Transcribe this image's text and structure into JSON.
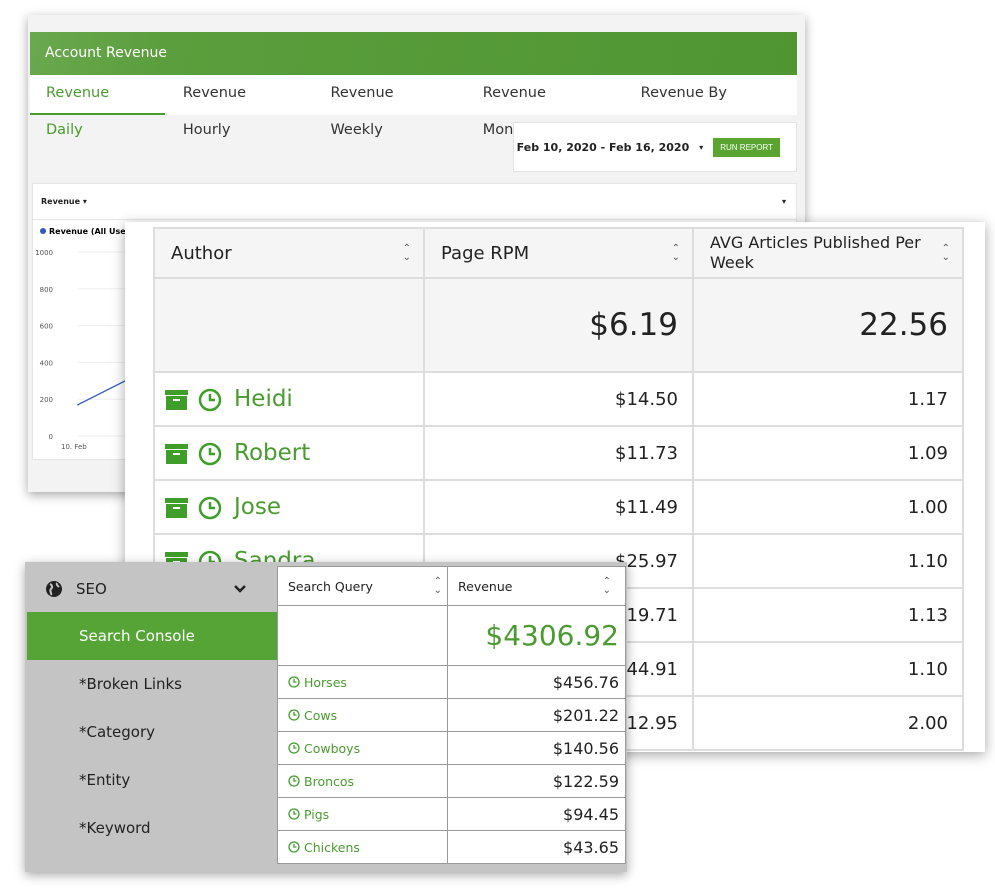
{
  "revenue_panel": {
    "title": "Account Revenue",
    "tabs": [
      "Revenue Daily",
      "Revenue Hourly",
      "Revenue Weekly",
      "Revenue Monthly",
      "Revenue By Device"
    ],
    "active_tab": "Revenue Daily",
    "date_range": "Feb 10, 2020 - Feb 16, 2020",
    "run_report_label": "RUN REPORT",
    "metric_select": "Revenue",
    "accent_color": "#4a9b2f"
  },
  "chart_data": {
    "type": "line",
    "legend": "Revenue (All Users)",
    "series": [
      {
        "name": "Revenue (All Users)",
        "color": "#2f5bb8",
        "values": [
          170
        ]
      }
    ],
    "x": [
      "10. Feb"
    ],
    "yticks": [
      "0",
      "200",
      "400",
      "600",
      "800",
      "1000"
    ],
    "ylim": [
      0,
      1000
    ],
    "grid": true,
    "legend_position": "top-left"
  },
  "author_table": {
    "headers": [
      "Author",
      "Page RPM",
      "AVG Articles Published Per Week"
    ],
    "totals": {
      "page_rpm": "$6.19",
      "avg_articles": "22.56"
    },
    "rows": [
      {
        "author": "Heidi",
        "page_rpm": "$14.50",
        "avg_articles": "1.17"
      },
      {
        "author": "Robert",
        "page_rpm": "$11.73",
        "avg_articles": "1.09"
      },
      {
        "author": "Jose",
        "page_rpm": "$11.49",
        "avg_articles": "1.00"
      },
      {
        "author": "Sandra",
        "page_rpm": "$25.97",
        "avg_articles": "1.10"
      },
      {
        "author": "",
        "page_rpm": "$19.71",
        "avg_articles": "1.13"
      },
      {
        "author": "",
        "page_rpm": "$44.91",
        "avg_articles": "1.10"
      },
      {
        "author": "",
        "page_rpm": "$12.95",
        "avg_articles": "2.00"
      }
    ]
  },
  "seo_panel": {
    "section": "SEO",
    "items": [
      "Search Console",
      "*Broken Links",
      "*Category",
      "*Entity",
      "*Keyword"
    ],
    "active_item": "Search Console",
    "headers": [
      "Search Query",
      "Revenue"
    ],
    "total": "$4306.92",
    "rows": [
      {
        "query": "Horses",
        "revenue": "$456.76"
      },
      {
        "query": "Cows",
        "revenue": "$201.22"
      },
      {
        "query": "Cowboys",
        "revenue": "$140.56"
      },
      {
        "query": "Broncos",
        "revenue": "$122.59"
      },
      {
        "query": "Pigs",
        "revenue": "$94.45"
      },
      {
        "query": "Chickens",
        "revenue": "$43.65"
      }
    ]
  }
}
